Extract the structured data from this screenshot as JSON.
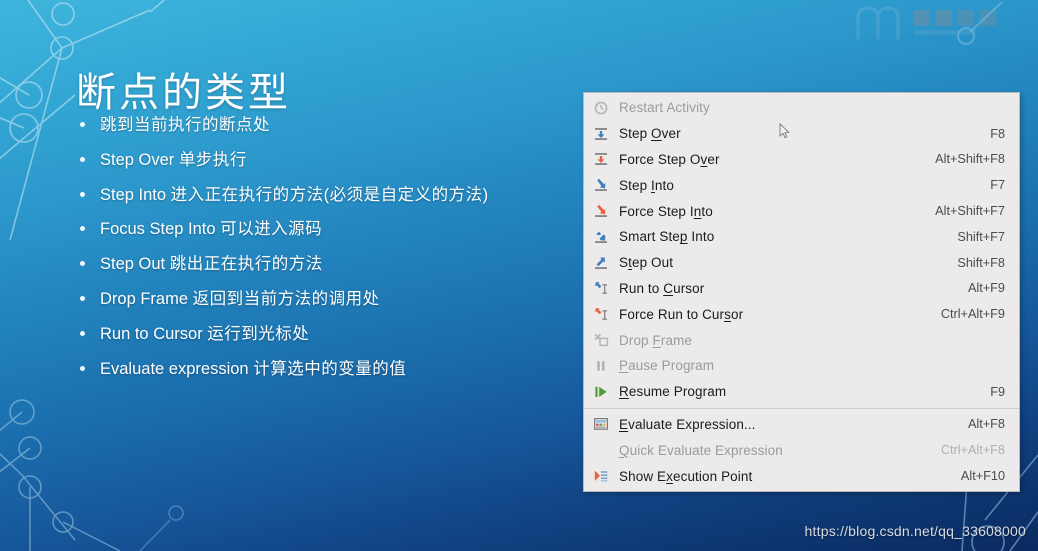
{
  "slide": {
    "title": "断点的类型",
    "bullets": [
      {
        "en": "",
        "cn": "跳到当前执行的断点处"
      },
      {
        "en": "Step Over ",
        "cn": "单步执行"
      },
      {
        "en": "Step Into ",
        "cn": "进入正在执行的方法(必须是自定义的方法)"
      },
      {
        "en": "Focus Step Into ",
        "cn": "可以进入源码"
      },
      {
        "en": "Step Out ",
        "cn": "跳出正在执行的方法"
      },
      {
        "en": "Drop Frame ",
        "cn": "返回到当前方法的调用处"
      },
      {
        "en": "Run to Cursor ",
        "cn": "运行到光标处"
      },
      {
        "en": "Evaluate expression ",
        "cn": "计算选中的变量的值"
      }
    ]
  },
  "context_menu": {
    "items": [
      {
        "label": "Restart Activity",
        "accel": "",
        "icon": "restart-icon",
        "disabled": true,
        "mnemonic": ""
      },
      {
        "label": "Step Over",
        "accel": "F8",
        "icon": "step-over-icon",
        "disabled": false,
        "mnemonic": "O"
      },
      {
        "label": "Force Step Over",
        "accel": "Alt+Shift+F8",
        "icon": "force-step-over-icon",
        "disabled": false,
        "mnemonic": "v"
      },
      {
        "label": "Step Into",
        "accel": "F7",
        "icon": "step-into-icon",
        "disabled": false,
        "mnemonic": "I"
      },
      {
        "label": "Force Step Into",
        "accel": "Alt+Shift+F7",
        "icon": "force-step-into-icon",
        "disabled": false,
        "mnemonic": "n"
      },
      {
        "label": "Smart Step Into",
        "accel": "Shift+F7",
        "icon": "smart-step-into-icon",
        "disabled": false,
        "mnemonic": "p"
      },
      {
        "label": "Step Out",
        "accel": "Shift+F8",
        "icon": "step-out-icon",
        "disabled": false,
        "mnemonic": "t"
      },
      {
        "label": "Run to Cursor",
        "accel": "Alt+F9",
        "icon": "run-to-cursor-icon",
        "disabled": false,
        "mnemonic": "C"
      },
      {
        "label": "Force Run to Cursor",
        "accel": "Ctrl+Alt+F9",
        "icon": "force-run-to-cursor-icon",
        "disabled": false,
        "mnemonic": "s"
      },
      {
        "label": "Drop Frame",
        "accel": "",
        "icon": "drop-frame-icon",
        "disabled": true,
        "mnemonic": "F"
      },
      {
        "label": "Pause Program",
        "accel": "",
        "icon": "pause-icon",
        "disabled": true,
        "mnemonic": "P"
      },
      {
        "label": "Resume Program",
        "accel": "F9",
        "icon": "resume-icon",
        "disabled": false,
        "mnemonic": "R"
      },
      {
        "separator": true
      },
      {
        "label": "Evaluate Expression...",
        "accel": "Alt+F8",
        "icon": "evaluate-expression-icon",
        "disabled": false,
        "mnemonic": "E"
      },
      {
        "label": "Quick Evaluate Expression",
        "accel": "Ctrl+Alt+F8",
        "icon": "",
        "disabled": true,
        "mnemonic": "Q"
      },
      {
        "label": "Show Execution Point",
        "accel": "Alt+F10",
        "icon": "show-execution-point-icon",
        "disabled": false,
        "mnemonic": "x"
      }
    ]
  },
  "watermark": {
    "url": "https://blog.csdn.net/qq_33608000"
  },
  "colors": {
    "menu_bg": "#eceaea",
    "menu_border": "#b9b9b9",
    "accel_text": "#4d4d4d",
    "disabled_text": "#9b9b9b",
    "slide_top": "#3fb5dd",
    "slide_bottom": "#0a2a60"
  }
}
